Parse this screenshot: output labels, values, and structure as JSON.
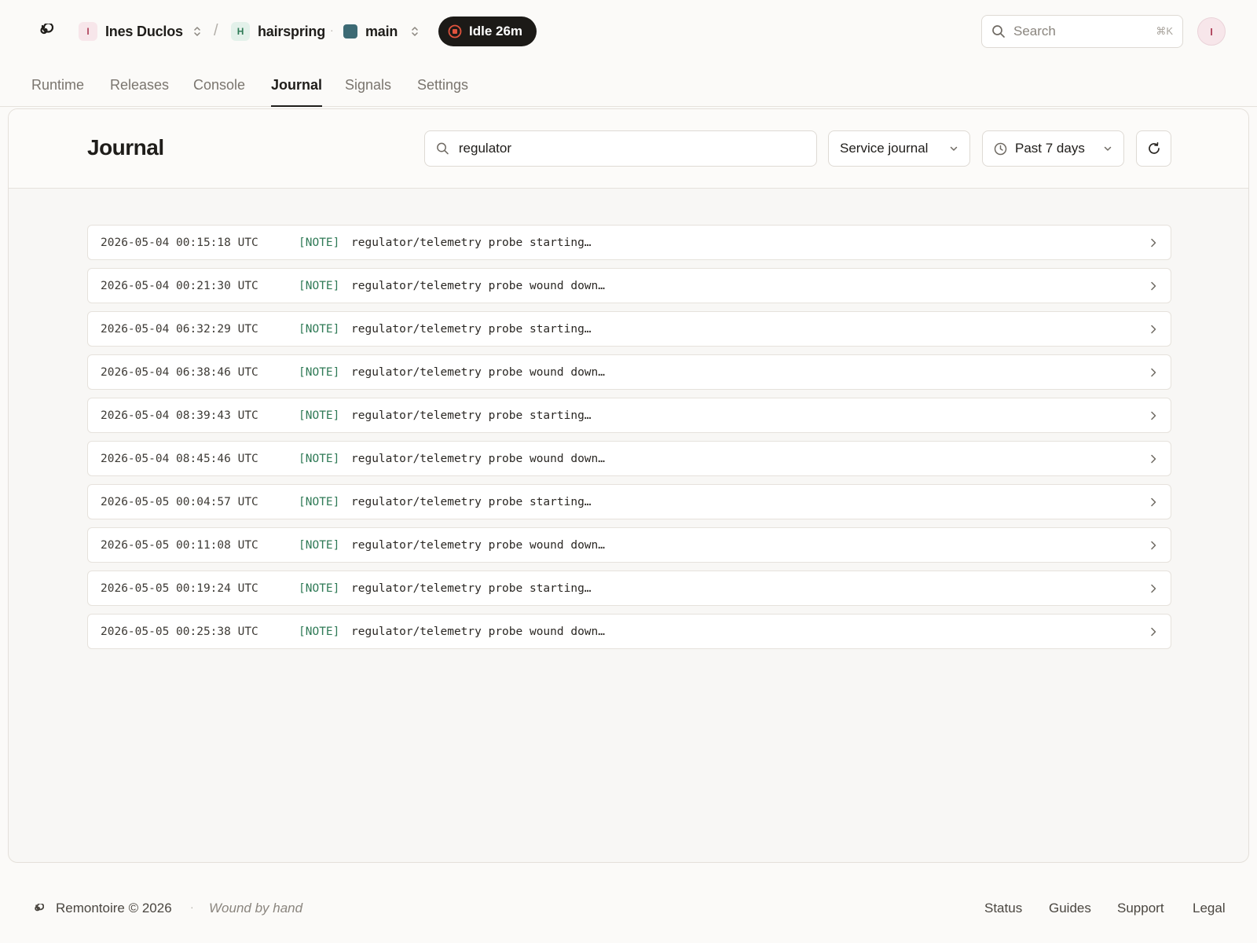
{
  "header": {
    "user": {
      "initial": "I",
      "name": "Ines Duclos"
    },
    "separator": "/",
    "project": {
      "initial": "H",
      "name": "hairspring"
    },
    "dot": "·",
    "branch": {
      "name": "main",
      "color": "#3c6a74"
    },
    "status_pill": "Idle 26m",
    "search": {
      "placeholder": "Search",
      "shortcut": "⌘K"
    },
    "avatar_initial": "I"
  },
  "tabs": [
    {
      "label": "Runtime",
      "active": false
    },
    {
      "label": "Releases",
      "active": false
    },
    {
      "label": "Console",
      "active": false
    },
    {
      "label": "Journal",
      "active": true
    },
    {
      "label": "Signals",
      "active": false
    },
    {
      "label": "Settings",
      "active": false
    }
  ],
  "journal": {
    "title": "Journal",
    "filter_value": "regulator",
    "source_select": "Service journal",
    "range_select": "Past 7 days",
    "entries": [
      {
        "timestamp": "2026-05-04 00:15:18 UTC",
        "level": "[NOTE]",
        "message": "regulator/telemetry probe starting…"
      },
      {
        "timestamp": "2026-05-04 00:21:30 UTC",
        "level": "[NOTE]",
        "message": "regulator/telemetry probe wound down…"
      },
      {
        "timestamp": "2026-05-04 06:32:29 UTC",
        "level": "[NOTE]",
        "message": "regulator/telemetry probe starting…"
      },
      {
        "timestamp": "2026-05-04 06:38:46 UTC",
        "level": "[NOTE]",
        "message": "regulator/telemetry probe wound down…"
      },
      {
        "timestamp": "2026-05-04 08:39:43 UTC",
        "level": "[NOTE]",
        "message": "regulator/telemetry probe starting…"
      },
      {
        "timestamp": "2026-05-04 08:45:46 UTC",
        "level": "[NOTE]",
        "message": "regulator/telemetry probe wound down…"
      },
      {
        "timestamp": "2026-05-05 00:04:57 UTC",
        "level": "[NOTE]",
        "message": "regulator/telemetry probe starting…"
      },
      {
        "timestamp": "2026-05-05 00:11:08 UTC",
        "level": "[NOTE]",
        "message": "regulator/telemetry probe wound down…"
      },
      {
        "timestamp": "2026-05-05 00:19:24 UTC",
        "level": "[NOTE]",
        "message": "regulator/telemetry probe starting…"
      },
      {
        "timestamp": "2026-05-05 00:25:38 UTC",
        "level": "[NOTE]",
        "message": "regulator/telemetry probe wound down…"
      }
    ]
  },
  "footer": {
    "brand": "Remontoire © 2026",
    "dot": "·",
    "tagline": "Wound by hand",
    "links": [
      "Status",
      "Guides",
      "Support",
      "Legal"
    ]
  },
  "colors": {
    "accent_note": "#2f7a56",
    "pill_bg": "#1c1a17",
    "recording_red": "#e0533d"
  }
}
